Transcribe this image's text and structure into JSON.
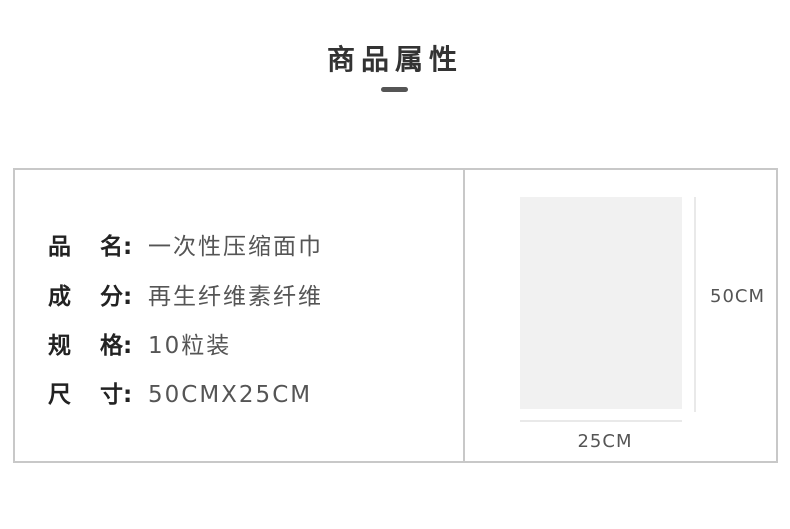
{
  "header": {
    "title": "商品属性"
  },
  "attributes": [
    {
      "label_first": "品",
      "label_rest": "名:",
      "value": "一次性压缩面巾"
    },
    {
      "label_first": "成",
      "label_rest": "分:",
      "value": "再生纤维素纤维"
    },
    {
      "label_first": "规",
      "label_rest": "格:",
      "value": "10粒装"
    },
    {
      "label_first": "尺",
      "label_rest": "寸:",
      "value": "50CMX25CM"
    }
  ],
  "illustration": {
    "height_label": "50CM",
    "width_label": "25CM"
  }
}
